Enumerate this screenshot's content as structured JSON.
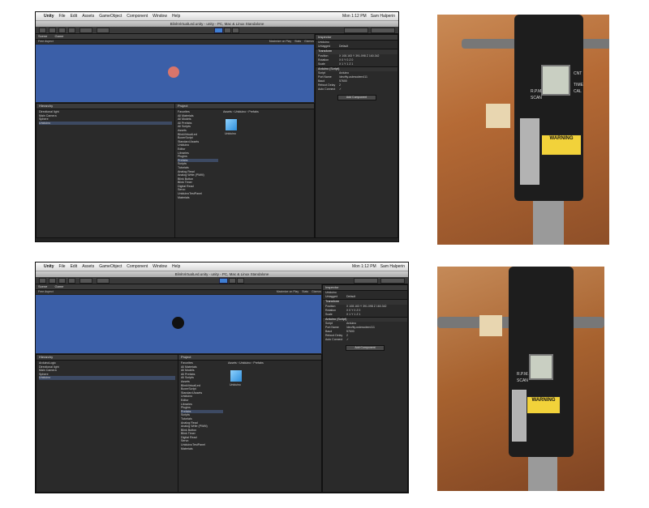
{
  "top": {
    "menubar": {
      "app": "Unity",
      "items": [
        "File",
        "Edit",
        "Assets",
        "GameObject",
        "Component",
        "Window",
        "Help"
      ],
      "time": "Mon 1:12 PM",
      "user": "Sam Halperin"
    },
    "window_title": "BlinkVirtualLed.unity - unity - PC, Mac & Linux Standalone",
    "tabs": {
      "scene": "Scene",
      "game": "Game"
    },
    "game_bar": {
      "aspect": "Free Aspect",
      "maximize": "Maximize on Play",
      "stats": "Stats",
      "gizmos": "Gizmos"
    },
    "hierarchy": {
      "title": "Hierarchy",
      "items": [
        "Directional light",
        "Main Camera",
        "Sphere",
        "Uniduino"
      ]
    },
    "project": {
      "title": "Project",
      "breadcrumb": "Assets › Uniduino › Prefabs",
      "favorites": [
        "Favorites",
        "All Materials",
        "All Models",
        "All Prefabs",
        "All Scripts"
      ],
      "assets": [
        "Assets",
        "BlinkVirtualLed",
        "BoxerScript",
        "Standard Assets",
        "Uniduino",
        "Editor",
        "Libraries",
        "Plugins",
        "Prefabs",
        "Scripts",
        "Tutorials",
        "Analog Read",
        "Analog Write (PWM)",
        "Blink Button",
        "Blink Timer",
        "Digital Read",
        "Servo",
        "UniduinoTestPanel",
        "Materials"
      ],
      "asset_name": "Uniduino"
    },
    "inspector": {
      "title": "Inspector",
      "object": "Uniduino",
      "tag": "Untagged",
      "layer": "Default",
      "transform": "Transform",
      "rows": [
        {
          "k": "Position",
          "v": "X 108.163  Y 391.098  Z 160.342"
        },
        {
          "k": "Rotation",
          "v": "X 0  Y 0  Z 0"
        },
        {
          "k": "Scale",
          "v": "X 1  Y 1  Z 1"
        }
      ],
      "script_header": "Arduino (Script)",
      "script_rows": [
        {
          "k": "Script",
          "v": "Arduino"
        },
        {
          "k": "Port Name",
          "v": "/dev/tty.usbmodem411"
        },
        {
          "k": "Baud",
          "v": "57600"
        },
        {
          "k": "Reboot Delay",
          "v": "2"
        },
        {
          "k": "Auto Connect",
          "v": "✓"
        }
      ],
      "add_component": "Add Component"
    },
    "ball_color": "#d9756b",
    "photo": {
      "warning": "WARNING",
      "labels": [
        "R.P.M.",
        "SCAN",
        "CNT",
        "TIME",
        "CAL"
      ]
    }
  },
  "bottom": {
    "menubar": {
      "app": "Unity",
      "items": [
        "File",
        "Edit",
        "Assets",
        "GameObject",
        "Component",
        "Window",
        "Help"
      ],
      "time": "Mon 1:12 PM",
      "user": "Sam Halperin"
    },
    "window_title": "BlinkVirtualLed.unity - unity - PC, Mac & Linux Standalone",
    "tabs": {
      "scene": "Scene",
      "game": "Game"
    },
    "game_bar": {
      "aspect": "Free Aspect",
      "maximize": "Maximize on Play",
      "stats": "Stats",
      "gizmos": "Gizmos"
    },
    "hierarchy": {
      "title": "Hierarchy",
      "items": [
        "ArduinoLogic",
        "Directional light",
        "Main Camera",
        "Sphere",
        "Uniduino"
      ]
    },
    "project": {
      "title": "Project",
      "breadcrumb": "Assets › Uniduino › Prefabs",
      "favorites": [
        "Favorites",
        "All Materials",
        "All Models",
        "All Prefabs",
        "All Scripts"
      ],
      "assets": [
        "Assets",
        "BlinkVirtualLed",
        "BoxerScript",
        "Standard Assets",
        "Uniduino",
        "Editor",
        "Libraries",
        "Plugins",
        "Prefabs",
        "Scripts",
        "Tutorials",
        "Analog Read",
        "Analog Write (PWM)",
        "Blink Button",
        "Blink Timer",
        "Digital Read",
        "Servo",
        "UniduinoTestPanel",
        "Materials"
      ],
      "asset_name": "Uniduino"
    },
    "inspector": {
      "title": "Inspector",
      "object": "Uniduino",
      "tag": "Untagged",
      "layer": "Default",
      "transform": "Transform",
      "rows": [
        {
          "k": "Position",
          "v": "X 108.163  Y 391.098  Z 160.342"
        },
        {
          "k": "Rotation",
          "v": "X 0  Y 0  Z 0"
        },
        {
          "k": "Scale",
          "v": "X 1  Y 1  Z 1"
        }
      ],
      "script_header": "Arduino (Script)",
      "script_rows": [
        {
          "k": "Script",
          "v": "Arduino"
        },
        {
          "k": "Port Name",
          "v": "/dev/tty.usbmodem411"
        },
        {
          "k": "Baud",
          "v": "57600"
        },
        {
          "k": "Reboot Delay",
          "v": "2"
        },
        {
          "k": "Auto Connect",
          "v": "✓"
        }
      ],
      "add_component": "Add Component"
    },
    "ball_color": "#111111",
    "photo": {
      "warning": "WARNING",
      "labels": [
        "R.P.M.",
        "SCAN"
      ]
    }
  }
}
